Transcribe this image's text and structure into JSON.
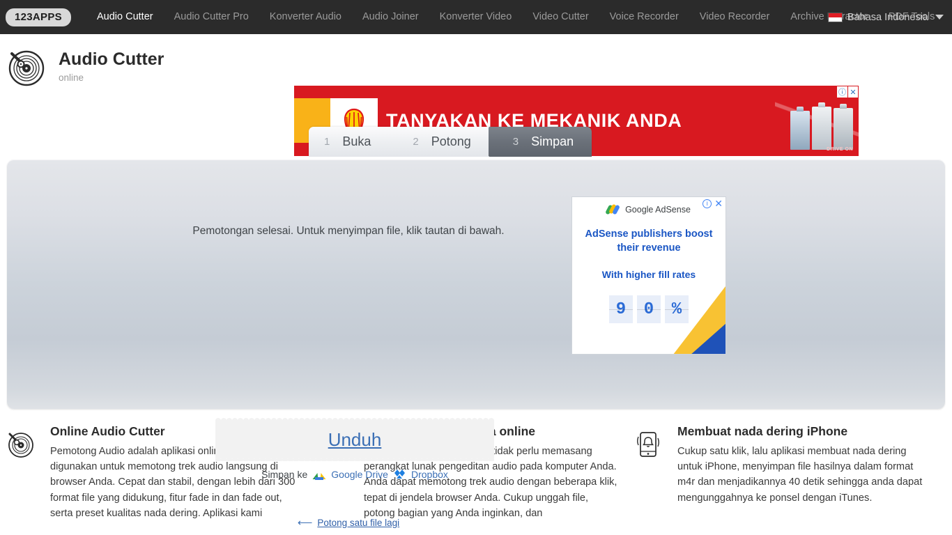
{
  "topnav": {
    "logo": "123APPS",
    "links": [
      {
        "label": "Audio Cutter",
        "active": true
      },
      {
        "label": "Audio Cutter Pro",
        "active": false
      },
      {
        "label": "Konverter Audio",
        "active": false
      },
      {
        "label": "Audio Joiner",
        "active": false
      },
      {
        "label": "Konverter Video",
        "active": false
      },
      {
        "label": "Video Cutter",
        "active": false
      },
      {
        "label": "Voice Recorder",
        "active": false
      },
      {
        "label": "Video Recorder",
        "active": false
      },
      {
        "label": "Archive Extractor",
        "active": false
      },
      {
        "label": "PDF Tools",
        "active": false
      }
    ],
    "language": "Bahasa Indonesia",
    "flag_icon": "indonesia-flag-icon",
    "chevron_icon": "chevron-down-icon"
  },
  "brand": {
    "icon": "vinyl-record-icon",
    "title": "Audio Cutter",
    "subtitle": "online"
  },
  "banner_ad": {
    "headline": "TANYAKAN KE MEKANIK ANDA",
    "brand_icon": "shell-logo-icon",
    "drive_on": "DRIVE ON",
    "info_icon": "ⓘ",
    "close_icon": "✕"
  },
  "steps": [
    {
      "num": "1",
      "label": "Buka",
      "active": false
    },
    {
      "num": "2",
      "label": "Potong",
      "active": false
    },
    {
      "num": "3",
      "label": "Simpan",
      "active": true
    }
  ],
  "main": {
    "done_message": "Pemotongan selesai. Untuk menyimpan file, klik tautan di bawah.",
    "download_label": "Unduh",
    "save_to_label": "Simpan ke",
    "google_drive_label": "Google Drive",
    "google_drive_icon": "google-drive-icon",
    "dropbox_label": "Dropbox",
    "dropbox_icon": "dropbox-icon",
    "again_arrow": "⟵",
    "again_label": "Potong satu file lagi"
  },
  "adsense": {
    "header": "Google AdSense",
    "logo_icon": "google-adsense-icon",
    "info_icon": "i",
    "close_icon": "✕",
    "line1": "AdSense publishers boost their revenue",
    "line2": "With higher fill rates",
    "counter": [
      "9",
      "0",
      "%"
    ]
  },
  "features": [
    {
      "icon": "vinyl-record-icon",
      "title": "Online Audio Cutter",
      "text": "Pemotong Audio adalah aplikasi online yang dapat digunakan untuk memotong trek audio langsung di browser Anda. Cepat dan stabil, dengan lebih dari 300 format file yang didukung, fitur fade in dan fade out, serta preset kualitas nada dering. Aplikasi kami"
    },
    {
      "icon": "globe-icon",
      "title": "Memotong lagu secara online",
      "text": "Dengan aplikasi kami, Anda tidak perlu memasang perangkat lunak pengeditan audio pada komputer Anda. Anda dapat memotong trek audio dengan beberapa klik, tepat di jendela browser Anda. Cukup unggah file, potong bagian yang Anda inginkan, dan"
    },
    {
      "icon": "phone-ringtone-icon",
      "title": "Membuat nada dering iPhone",
      "text": "Cukup satu klik, lalu aplikasi membuat nada dering untuk iPhone, menyimpan file hasilnya dalam format m4r dan menjadikannya 40 detik sehingga anda dapat mengunggahnya ke ponsel dengan iTunes."
    }
  ],
  "colors": {
    "nav_bg": "#2b2b2b",
    "active_step": "#6a7079",
    "link_blue": "#3b6fb5",
    "ad_red": "#d81920",
    "adsense_blue": "#1a56c4"
  }
}
